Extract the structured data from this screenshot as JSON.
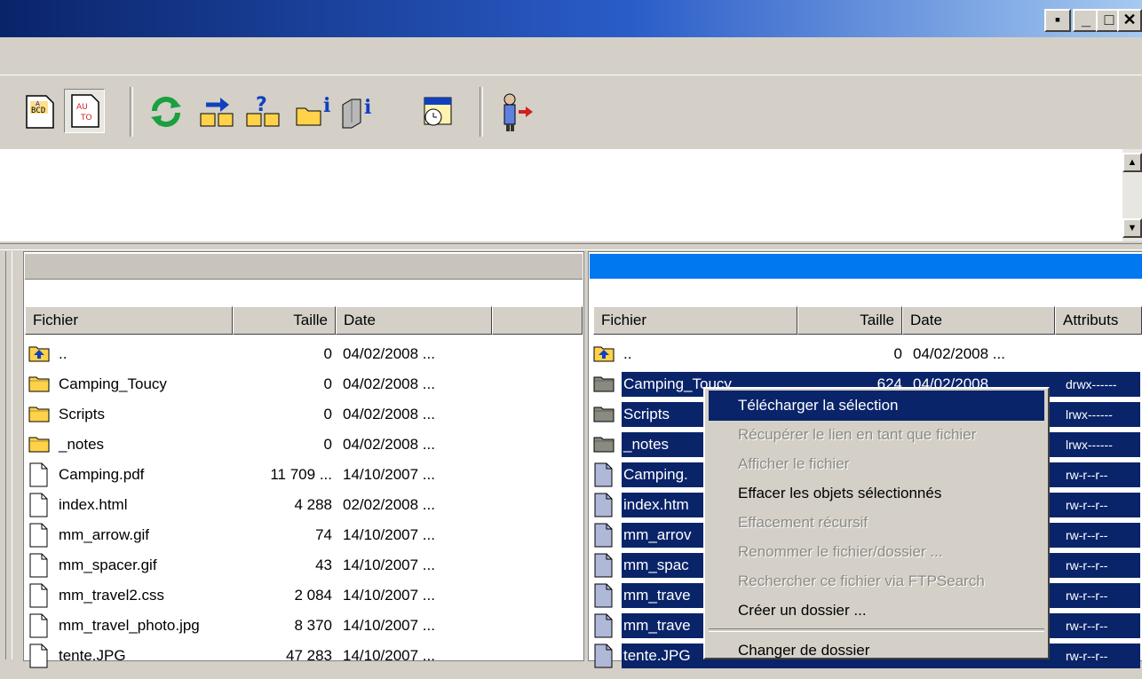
{
  "window": {
    "title": "",
    "controls": [
      "restore-inner",
      "minimize",
      "maximize",
      "close"
    ]
  },
  "toolbar": {
    "buttons": [
      {
        "name": "ascii-mode-icon"
      },
      {
        "name": "auto-mode-icon",
        "pressed": true
      },
      {
        "name": "refresh-icon"
      },
      {
        "name": "upload-icon"
      },
      {
        "name": "download-query-icon"
      },
      {
        "name": "folder-info-icon"
      },
      {
        "name": "disk-info-icon"
      },
      {
        "name": "schedule-icon"
      },
      {
        "name": "disconnect-icon"
      }
    ]
  },
  "local_panel": {
    "columns": [
      "Fichier",
      "Taille",
      "Date"
    ],
    "rows": [
      {
        "type": "up",
        "name": "..",
        "size": "0",
        "date": "04/02/2008 ..."
      },
      {
        "type": "folder",
        "name": "Camping_Toucy",
        "size": "0",
        "date": "04/02/2008 ..."
      },
      {
        "type": "folder",
        "name": "Scripts",
        "size": "0",
        "date": "04/02/2008 ..."
      },
      {
        "type": "folder",
        "name": "_notes",
        "size": "0",
        "date": "04/02/2008 ..."
      },
      {
        "type": "file",
        "name": "Camping.pdf",
        "size": "11 709 ...",
        "date": "14/10/2007 ..."
      },
      {
        "type": "file",
        "name": "index.html",
        "size": "4 288",
        "date": "02/02/2008 ..."
      },
      {
        "type": "file",
        "name": "mm_arrow.gif",
        "size": "74",
        "date": "14/10/2007 ..."
      },
      {
        "type": "file",
        "name": "mm_spacer.gif",
        "size": "43",
        "date": "14/10/2007 ..."
      },
      {
        "type": "file",
        "name": "mm_travel2.css",
        "size": "2 084",
        "date": "14/10/2007 ..."
      },
      {
        "type": "file",
        "name": "mm_travel_photo.jpg",
        "size": "8 370",
        "date": "14/10/2007 ..."
      },
      {
        "type": "file",
        "name": "tente.JPG",
        "size": "47 283",
        "date": "14/10/2007 ..."
      }
    ]
  },
  "remote_panel": {
    "columns": [
      "Fichier",
      "Taille",
      "Date",
      "Attributs"
    ],
    "rows": [
      {
        "type": "up",
        "name": "..",
        "size": "0",
        "date": "04/02/2008 ...",
        "attr": "",
        "selected": false
      },
      {
        "type": "folder",
        "name": "Camping_Toucy",
        "size": "624",
        "date": "04/02/2008",
        "attr": "drwx------",
        "selected": true
      },
      {
        "type": "folder",
        "name": "Scripts",
        "size": "",
        "date": "",
        "attr": "lrwx------",
        "selected": true
      },
      {
        "type": "folder",
        "name": "_notes",
        "size": "",
        "date": "",
        "attr": "lrwx------",
        "selected": true
      },
      {
        "type": "file",
        "name": "Camping.",
        "size": "",
        "date": "",
        "attr": "rw-r--r--",
        "selected": true
      },
      {
        "type": "file",
        "name": "index.htm",
        "size": "",
        "date": "",
        "attr": "rw-r--r--",
        "selected": true
      },
      {
        "type": "file",
        "name": "mm_arrov",
        "size": "",
        "date": "",
        "attr": "rw-r--r--",
        "selected": true
      },
      {
        "type": "file",
        "name": "mm_spac",
        "size": "",
        "date": "",
        "attr": "rw-r--r--",
        "selected": true
      },
      {
        "type": "file",
        "name": "mm_trave",
        "size": "",
        "date": "",
        "attr": "rw-r--r--",
        "selected": true
      },
      {
        "type": "file",
        "name": "mm_trave",
        "size": "",
        "date": "",
        "attr": "rw-r--r--",
        "selected": true
      },
      {
        "type": "file",
        "name": "tente.JPG",
        "size": "",
        "date": "",
        "attr": "rw-r--r--",
        "selected": true
      }
    ]
  },
  "context_menu": {
    "items": [
      {
        "label": "Télécharger la sélection",
        "state": "highlighted"
      },
      {
        "label": "Récupérer le lien en tant que fichier",
        "state": "disabled"
      },
      {
        "label": "Afficher le fichier",
        "state": "disabled"
      },
      {
        "label": "Effacer les objets sélectionnés",
        "state": "enabled"
      },
      {
        "label": "Effacement récursif",
        "state": "disabled"
      },
      {
        "label": "Renommer le fichier/dossier ...",
        "state": "disabled"
      },
      {
        "label": "Rechercher ce fichier via FTPSearch",
        "state": "disabled"
      },
      {
        "label": "Créer un dossier ...",
        "state": "enabled"
      },
      {
        "label": "Changer de dossier",
        "state": "enabled",
        "separator_before": true
      }
    ]
  },
  "colors": {
    "title_start": "#0a246a",
    "title_end": "#a6caf0",
    "selection": "#0a246a",
    "remote_panel_bar": "#0078f0",
    "face": "#d4d0c8"
  }
}
